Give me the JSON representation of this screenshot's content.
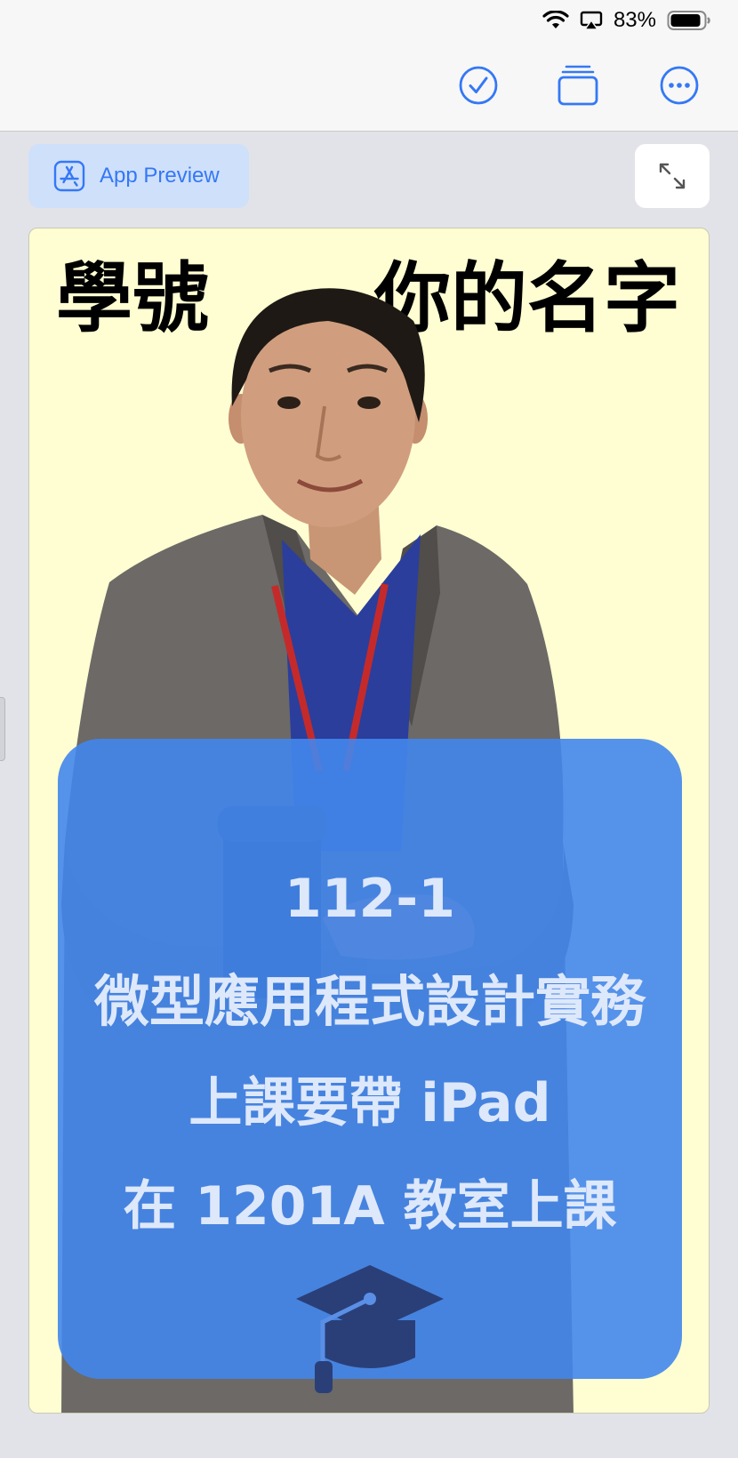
{
  "status_bar": {
    "battery_percent": "83%",
    "icons": [
      "wifi-icon",
      "airplay-icon",
      "battery-icon"
    ]
  },
  "toolbar": {
    "icons": [
      "checkmark-circle-icon",
      "stacked-windows-icon",
      "more-ellipsis-icon"
    ],
    "accent_color": "#3478f6"
  },
  "app_preview": {
    "label": "App Preview",
    "icon": "app-store-icon"
  },
  "expand": {
    "icon": "expand-arrows-icon"
  },
  "canvas": {
    "background_color": "#fefed2",
    "heading_left": "學號",
    "heading_right": "你的名字",
    "card_color": "#4286ec",
    "lines": [
      "112-1",
      "微型應用程式設計實務",
      "上課要帶 iPad",
      "在 1201A 教室上課"
    ],
    "cap_icon": "graduation-cap-icon"
  }
}
